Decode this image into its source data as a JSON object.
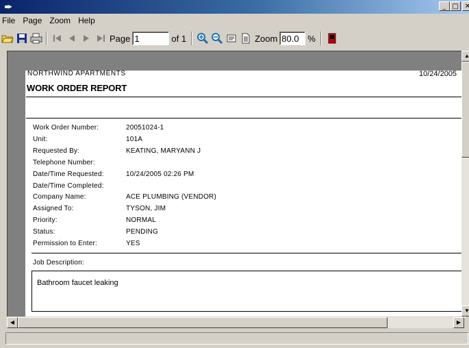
{
  "menubar": {
    "items": [
      "File",
      "Page",
      "Zoom",
      "Help"
    ]
  },
  "toolbar": {
    "page_label": "Page",
    "page_value": "1",
    "of_label": "of 1",
    "zoom_label": "Zoom",
    "zoom_value": "80.0",
    "zoom_unit": "%",
    "icons": [
      "open-folder-icon",
      "save-icon",
      "print-icon",
      "first-page-icon",
      "prev-page-icon",
      "next-page-icon",
      "last-page-icon",
      "zoom-in-icon",
      "zoom-out-icon",
      "page-width-icon",
      "whole-page-icon",
      "exit-icon"
    ]
  },
  "report": {
    "company": "NORTHWIND APARTMENTS",
    "date": "10/24/2005",
    "title": "WORK ORDER REPORT",
    "fields": [
      {
        "label": "Work Order Number:",
        "value": "20051024-1"
      },
      {
        "label": "Unit:",
        "value": "101A"
      },
      {
        "label": "Requested By:",
        "value": "KEATING, MARYANN J"
      },
      {
        "label": "Telephone Number:",
        "value": ""
      },
      {
        "label": "Date/Time Requested:",
        "value": "10/24/2005 02:26 PM"
      },
      {
        "label": "Date/Time Completed:",
        "value": ""
      },
      {
        "label": "Company Name:",
        "value": "ACE PLUMBING (VENDOR)"
      },
      {
        "label": "Assigned To:",
        "value": "TYSON, JIM"
      },
      {
        "label": "Priority:",
        "value": "NORMAL"
      },
      {
        "label": "Status:",
        "value": "PENDING"
      },
      {
        "label": "Permission to Enter:",
        "value": "YES"
      }
    ],
    "job_description_label": "Job Description:",
    "job_description": "Bathroom faucet leaking"
  }
}
